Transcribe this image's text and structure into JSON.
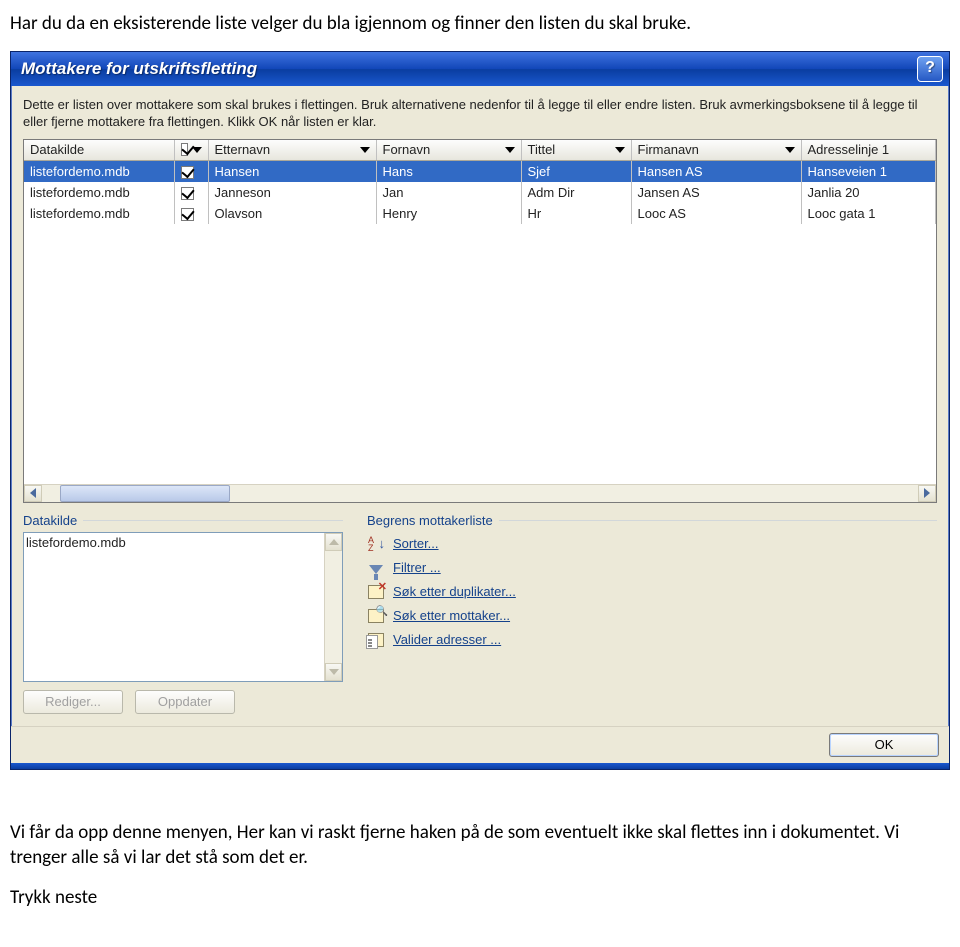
{
  "doc": {
    "intro": "Har du da en eksisterende liste velger du bla igjennom og finner den listen du skal bruke.",
    "outro1": "Vi får da opp denne menyen, Her kan vi raskt fjerne haken på de som eventuelt ikke skal flettes inn i dokumentet. Vi trenger alle så vi lar det stå som det er.",
    "outro2": "Trykk neste"
  },
  "dialog": {
    "title": "Mottakere for utskriftsfletting",
    "help": "?",
    "description": "Dette er listen over mottakere som skal brukes i flettingen. Bruk alternativene nedenfor til å legge til eller endre listen. Bruk avmerkingsboksene til å legge til eller fjerne mottakere fra flettingen. Klikk OK når listen er klar.",
    "columns": [
      "Datakilde",
      "",
      "Etternavn",
      "Fornavn",
      "Tittel",
      "Firmanavn",
      "Adresselinje 1"
    ],
    "rows": [
      {
        "selected": true,
        "src": "listefordemo.mdb",
        "checked": true,
        "last": "Hansen",
        "first": "Hans",
        "title": "Sjef",
        "firm": "Hansen AS",
        "addr": "Hanseveien 1"
      },
      {
        "selected": false,
        "src": "listefordemo.mdb",
        "checked": true,
        "last": "Janneson",
        "first": "Jan",
        "title": "Adm Dir",
        "firm": "Jansen AS",
        "addr": "Janlia 20"
      },
      {
        "selected": false,
        "src": "listefordemo.mdb",
        "checked": true,
        "last": "Olavson",
        "first": "Henry",
        "title": "Hr",
        "firm": "Looc AS",
        "addr": "Looc gata 1"
      }
    ],
    "datakilde": {
      "label": "Datakilde",
      "items": [
        "listefordemo.mdb"
      ],
      "edit_btn": "Rediger...",
      "refresh_btn": "Oppdater"
    },
    "refine": {
      "label": "Begrens mottakerliste",
      "items": [
        {
          "id": "sort",
          "label": "Sorter..."
        },
        {
          "id": "filter",
          "label": "Filtrer ..."
        },
        {
          "id": "duplicates",
          "label": "Søk etter duplikater..."
        },
        {
          "id": "find",
          "label": "Søk etter mottaker..."
        },
        {
          "id": "validate",
          "label": "Valider adresser ..."
        }
      ]
    },
    "ok": "OK"
  }
}
